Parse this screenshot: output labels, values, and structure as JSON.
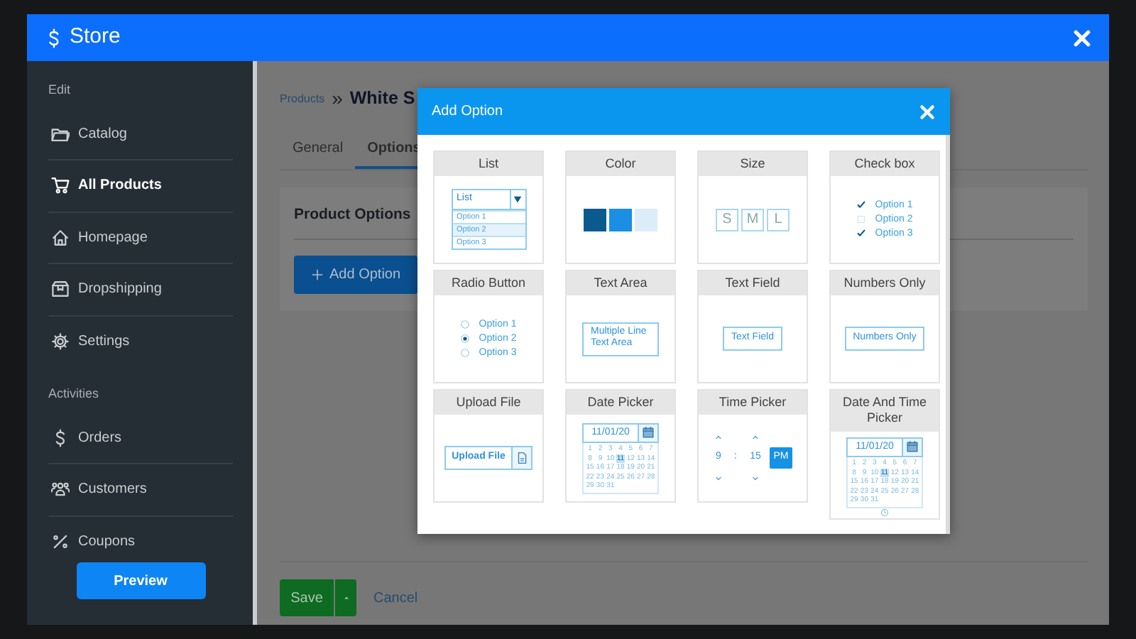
{
  "store": {
    "title": "Store"
  },
  "sidebar": {
    "sections": [
      {
        "label": "Edit",
        "items": [
          {
            "label": "Catalog",
            "selected": false
          },
          {
            "label": "All Products",
            "selected": true
          },
          {
            "label": "Homepage",
            "selected": false
          },
          {
            "label": "Dropshipping",
            "selected": false
          },
          {
            "label": "Settings",
            "selected": false
          }
        ]
      },
      {
        "label": "Activities",
        "items": [
          {
            "label": "Orders",
            "selected": false
          },
          {
            "label": "Customers",
            "selected": false
          },
          {
            "label": "Coupons",
            "selected": false
          }
        ]
      }
    ],
    "preview_button": "Preview"
  },
  "breadcrumb": {
    "parent": "Products",
    "separator": "»",
    "current": "White S"
  },
  "tabs": [
    {
      "label": "General",
      "selected": false
    },
    {
      "label": "Options",
      "selected": true
    }
  ],
  "panel": {
    "title": "Product Options",
    "add_button": "Add Option"
  },
  "footer": {
    "save": "Save",
    "cancel": "Cancel"
  },
  "modal": {
    "title": "Add Option",
    "option_types": [
      {
        "kind": "list",
        "title": "List",
        "value": "List",
        "options": [
          {
            "label": "Option 1",
            "selected": false
          },
          {
            "label": "Option 2",
            "selected": true
          },
          {
            "label": "Option 3",
            "selected": false
          }
        ]
      },
      {
        "kind": "color",
        "title": "Color",
        "swatches": [
          {
            "color": "#0b5a8e"
          },
          {
            "color": "#1a8fe3"
          },
          {
            "color": "#dcedfa"
          }
        ]
      },
      {
        "kind": "size",
        "title": "Size",
        "sizes": [
          "S",
          "M",
          "L"
        ]
      },
      {
        "kind": "checkbox",
        "title": "Check box",
        "options": [
          {
            "label": "Option 1",
            "checked": true
          },
          {
            "label": "Option 2",
            "checked": false
          },
          {
            "label": "Option 3",
            "checked": true
          }
        ]
      },
      {
        "kind": "radio",
        "title": "Radio Button",
        "options": [
          {
            "label": "Option 1",
            "selected": false
          },
          {
            "label": "Option 2",
            "selected": true
          },
          {
            "label": "Option 3",
            "selected": false
          }
        ]
      },
      {
        "kind": "textarea",
        "title": "Text Area",
        "value": "Multiple Line Text Area"
      },
      {
        "kind": "textfield",
        "title": "Text Field",
        "value": "Text Field"
      },
      {
        "kind": "textfield",
        "title": "Numbers Only",
        "value": "Numbers Only"
      },
      {
        "kind": "upload",
        "title": "Upload File",
        "value": "Upload File"
      },
      {
        "kind": "date",
        "title": "Date Picker",
        "value": "11/01/20",
        "days": [
          {
            "label": "1",
            "selected": false
          },
          {
            "label": "2",
            "selected": false
          },
          {
            "label": "3",
            "selected": false
          },
          {
            "label": "4",
            "selected": false
          },
          {
            "label": "5",
            "selected": false
          },
          {
            "label": "6",
            "selected": false
          },
          {
            "label": "7",
            "selected": false
          },
          {
            "label": "8",
            "selected": false
          },
          {
            "label": "9",
            "selected": false
          },
          {
            "label": "10",
            "selected": false
          },
          {
            "label": "11",
            "selected": true
          },
          {
            "label": "12",
            "selected": false
          },
          {
            "label": "13",
            "selected": false
          },
          {
            "label": "14",
            "selected": false
          },
          {
            "label": "15",
            "selected": false
          },
          {
            "label": "16",
            "selected": false
          },
          {
            "label": "17",
            "selected": false
          },
          {
            "label": "18",
            "selected": false
          },
          {
            "label": "19",
            "selected": false
          },
          {
            "label": "20",
            "selected": false
          },
          {
            "label": "21",
            "selected": false
          },
          {
            "label": "22",
            "selected": false
          },
          {
            "label": "23",
            "selected": false
          },
          {
            "label": "24",
            "selected": false
          },
          {
            "label": "25",
            "selected": false
          },
          {
            "label": "26",
            "selected": false
          },
          {
            "label": "27",
            "selected": false
          },
          {
            "label": "28",
            "selected": false
          },
          {
            "label": "29",
            "selected": false
          },
          {
            "label": "30",
            "selected": false
          },
          {
            "label": "31",
            "selected": false
          }
        ]
      },
      {
        "kind": "time",
        "title": "Time Picker",
        "hour": "9",
        "separator": ":",
        "minute": "15",
        "meridiem": "PM"
      },
      {
        "kind": "datetime",
        "title": "Date And Time Picker",
        "value": "11/01/20",
        "days": [
          {
            "label": "1",
            "selected": false
          },
          {
            "label": "2",
            "selected": false
          },
          {
            "label": "3",
            "selected": false
          },
          {
            "label": "4",
            "selected": false
          },
          {
            "label": "5",
            "selected": false
          },
          {
            "label": "6",
            "selected": false
          },
          {
            "label": "7",
            "selected": false
          },
          {
            "label": "8",
            "selected": false
          },
          {
            "label": "9",
            "selected": false
          },
          {
            "label": "10",
            "selected": false
          },
          {
            "label": "11",
            "selected": true
          },
          {
            "label": "12",
            "selected": false
          },
          {
            "label": "13",
            "selected": false
          },
          {
            "label": "14",
            "selected": false
          },
          {
            "label": "15",
            "selected": false
          },
          {
            "label": "16",
            "selected": false
          },
          {
            "label": "17",
            "selected": false
          },
          {
            "label": "18",
            "selected": false
          },
          {
            "label": "19",
            "selected": false
          },
          {
            "label": "20",
            "selected": false
          },
          {
            "label": "21",
            "selected": false
          },
          {
            "label": "22",
            "selected": false
          },
          {
            "label": "23",
            "selected": false
          },
          {
            "label": "24",
            "selected": false
          },
          {
            "label": "25",
            "selected": false
          },
          {
            "label": "26",
            "selected": false
          },
          {
            "label": "27",
            "selected": false
          },
          {
            "label": "28",
            "selected": false
          },
          {
            "label": "29",
            "selected": false
          },
          {
            "label": "30",
            "selected": false
          },
          {
            "label": "31",
            "selected": false
          }
        ]
      }
    ]
  }
}
